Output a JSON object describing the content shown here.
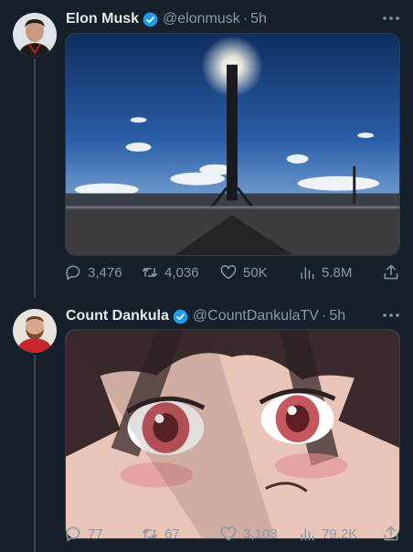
{
  "tweets": [
    {
      "display_name": "Elon Musk",
      "handle": "@elonmusk",
      "separator": "·",
      "time": "5h",
      "media_description": "rocket-booster-photo",
      "actions": {
        "replies": "3,476",
        "retweets": "4,036",
        "likes": "50K",
        "views": "5.8M"
      }
    },
    {
      "display_name": "Count Dankula",
      "handle": "@CountDankulaTV",
      "separator": "·",
      "time": "5h",
      "media_description": "anime-eyes-closeup",
      "actions": {
        "replies": "77",
        "retweets": "67",
        "likes": "3,103",
        "views": "79.2K"
      }
    }
  ],
  "colors": {
    "background": "#15202b",
    "text": "#e7e9ea",
    "muted": "#8b98a5",
    "verified": "#1d9bf0",
    "divider": "#38444d"
  }
}
